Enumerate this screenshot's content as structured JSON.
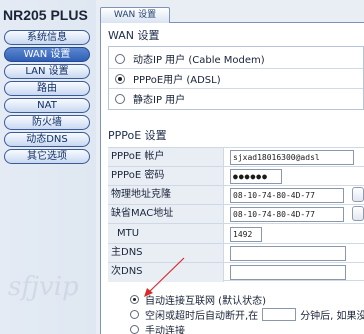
{
  "brand": "NR205 PLUS",
  "sidebar": {
    "items": [
      {
        "label": "系统信息",
        "active": false
      },
      {
        "label": "WAN 设置",
        "active": true
      },
      {
        "label": "LAN 设置",
        "active": false
      },
      {
        "label": "路由",
        "active": false
      },
      {
        "label": "NAT",
        "active": false
      },
      {
        "label": "防火墙",
        "active": false
      },
      {
        "label": "动态DNS",
        "active": false
      },
      {
        "label": "其它选项",
        "active": false
      }
    ]
  },
  "tab": {
    "label": "WAN 设置"
  },
  "wan": {
    "title": "WAN 设置",
    "options": [
      {
        "label": "动态IP 用户  (Cable Modem)",
        "checked": false
      },
      {
        "label": "PPPoE用户  (ADSL)",
        "checked": true
      },
      {
        "label": "静态IP 用户",
        "checked": false
      }
    ]
  },
  "pppoe": {
    "title": "PPPoE 设置",
    "account_label": "PPPoE 帐户",
    "account_value": "sjxad18016300@adsl",
    "password_label": "PPPoE 密码",
    "password_value": "●●●●●●",
    "mac_clone_label": "物理地址克隆",
    "mac_clone_value": "08-10-74-80-4D-77",
    "default_mac_label": "缺省MAC地址",
    "default_mac_value": "08-10-74-80-4D-77",
    "mtu_label": "MTU",
    "mtu_value": "1492",
    "primary_dns_label": "主DNS",
    "primary_dns_value": "",
    "secondary_dns_label": "次DNS",
    "secondary_dns_value": "",
    "connect_options": [
      {
        "label": "自动连接互联网  (默认状态)",
        "checked": true
      },
      {
        "pre": "空闲或超时后自动断开,在",
        "post": "分钟后, 如果没有",
        "checked": false
      },
      {
        "label": "手动连接",
        "checked": false
      }
    ]
  },
  "watermark": "sfjvip",
  "colors": {
    "accent": "#2f5fb6",
    "annotation": "#d62b2b",
    "panel_bg": "#ffffff",
    "label_bg": "#e9eef5"
  }
}
